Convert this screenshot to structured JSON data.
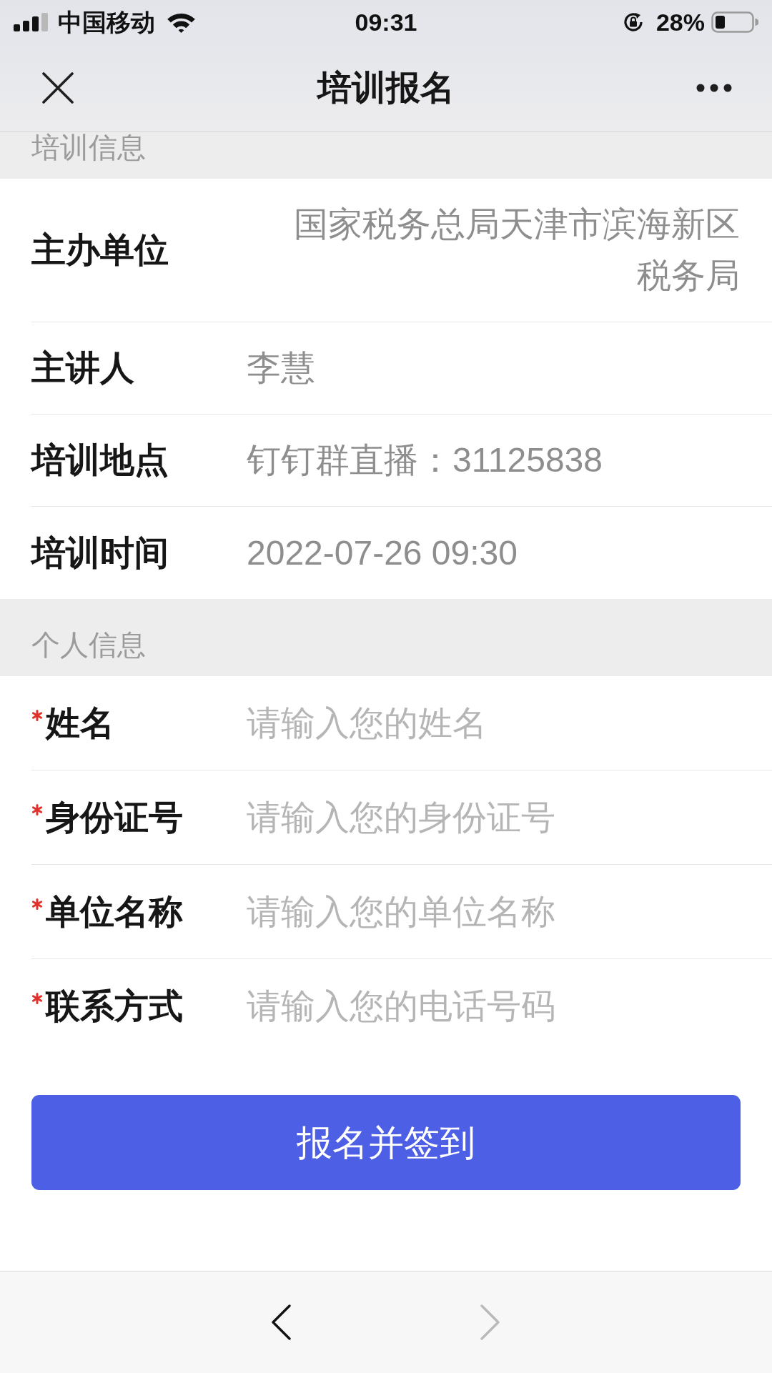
{
  "status_bar": {
    "carrier": "中国移动",
    "time": "09:31",
    "battery": "28%"
  },
  "header": {
    "title": "培训报名"
  },
  "sections": [
    {
      "kind": "info",
      "title": "培训信息",
      "rows": [
        {
          "kind": "wrapped",
          "label": "主办单位",
          "value": "国家税务总局天津市滨海新区税务局"
        },
        {
          "kind": "plain",
          "label": "主讲人",
          "value": "李慧"
        },
        {
          "kind": "plain",
          "label": "培训地点",
          "value": "钉钉群直播：31125838"
        },
        {
          "kind": "plain",
          "label": "培训时间",
          "value": "2022-07-26 09:30"
        }
      ]
    },
    {
      "kind": "form",
      "title": "个人信息",
      "fields": [
        {
          "label": "姓名",
          "required": true,
          "placeholder": "请输入您的姓名"
        },
        {
          "label": "身份证号",
          "required": true,
          "placeholder": "请输入您的身份证号"
        },
        {
          "label": "单位名称",
          "required": true,
          "placeholder": "请输入您的单位名称"
        },
        {
          "label": "联系方式",
          "required": true,
          "placeholder": "请输入您的电话号码"
        }
      ]
    }
  ],
  "submit_button": {
    "label": "报名并签到"
  },
  "bottom_nav": {
    "back": {
      "disabled": false
    },
    "forward": {
      "disabled": true
    }
  }
}
